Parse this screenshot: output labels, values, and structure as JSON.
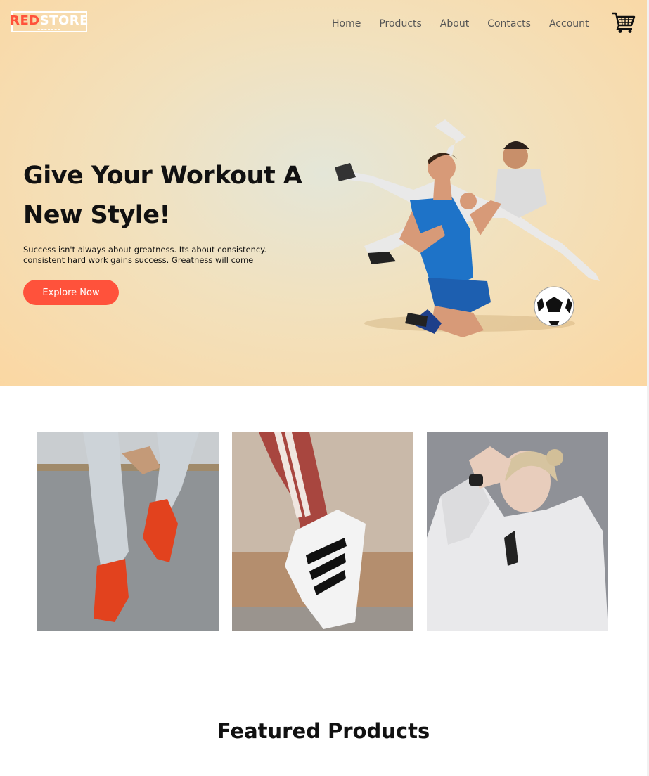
{
  "brand": {
    "logo_red": "RED",
    "logo_white": "STORE",
    "accent_color": "#ff523b"
  },
  "nav": {
    "items": [
      "Home",
      "Products",
      "About",
      "Contacts",
      "Account"
    ],
    "cart_icon": "shopping-cart-icon"
  },
  "hero": {
    "title": "Give Your Workout A New Style!",
    "description_line1": "Success isn't always about greatness. Its about consistency.",
    "description_line2": "consistent hard work gains success. Greatness will come",
    "cta_label": "Explore Now"
  },
  "categories": [
    {
      "icon": "red-sneakers-photo"
    },
    {
      "icon": "white-sneaker-photo"
    },
    {
      "icon": "white-hoodie-photo"
    }
  ],
  "featured": {
    "title": "Featured Products"
  }
}
